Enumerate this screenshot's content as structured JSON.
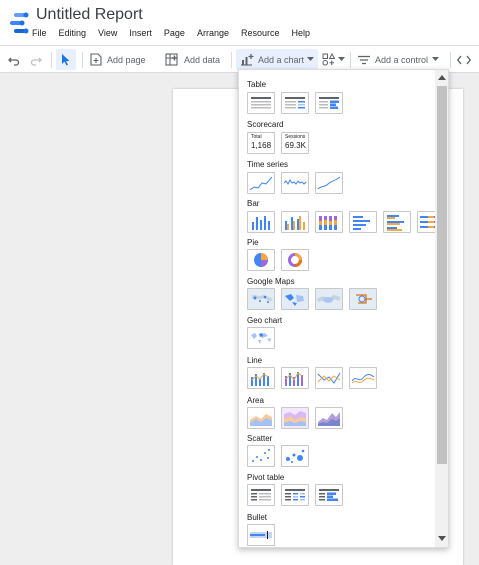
{
  "header": {
    "title": "Untitled Report",
    "menu": [
      "File",
      "Editing",
      "View",
      "Insert",
      "Page",
      "Arrange",
      "Resource",
      "Help"
    ]
  },
  "toolbar": {
    "add_page": "Add page",
    "add_data": "Add data",
    "add_chart": "Add a chart",
    "add_control": "Add a control"
  },
  "chart_menu": {
    "sections": [
      "Table",
      "Scorecard",
      "Time series",
      "Bar",
      "Pie",
      "Google Maps",
      "Geo chart",
      "Line",
      "Area",
      "Scatter",
      "Pivot table",
      "Bullet"
    ],
    "scorecards": [
      {
        "label": "Total",
        "value": "1,168"
      },
      {
        "label": "Sessions",
        "value": "69.3K"
      }
    ]
  },
  "colors": {
    "accent_blue": "#4285f4",
    "orange": "#f4a742",
    "purple": "#9c6ade",
    "selected_bg": "#e8f0fe"
  }
}
